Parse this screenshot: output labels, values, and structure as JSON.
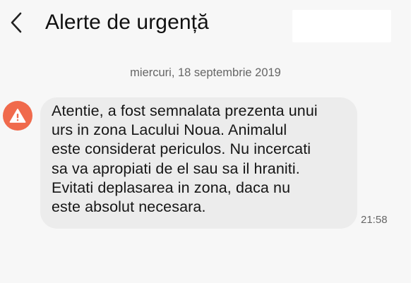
{
  "header": {
    "title": "Alerte de urgență",
    "back_icon": "chevron-left-icon"
  },
  "conversation": {
    "date_separator": "miercuri, 18 septembrie 2019",
    "message": {
      "icon": "warning-icon",
      "icon_color": "#f06a4c",
      "text": "Atentie, a fost semnalata prezenta unui\nurs in zona Lacului Noua. Animalul\neste considerat periculos. Nu incercati\nsa va apropiati de el sau sa il hraniti.\nEvitati deplasarea in zona, daca nu\neste absolut necesara.",
      "time": "21:58"
    }
  },
  "colors": {
    "background": "#f7f7f7",
    "bubble": "#ececec",
    "text": "#151515",
    "secondary_text": "#666666"
  }
}
